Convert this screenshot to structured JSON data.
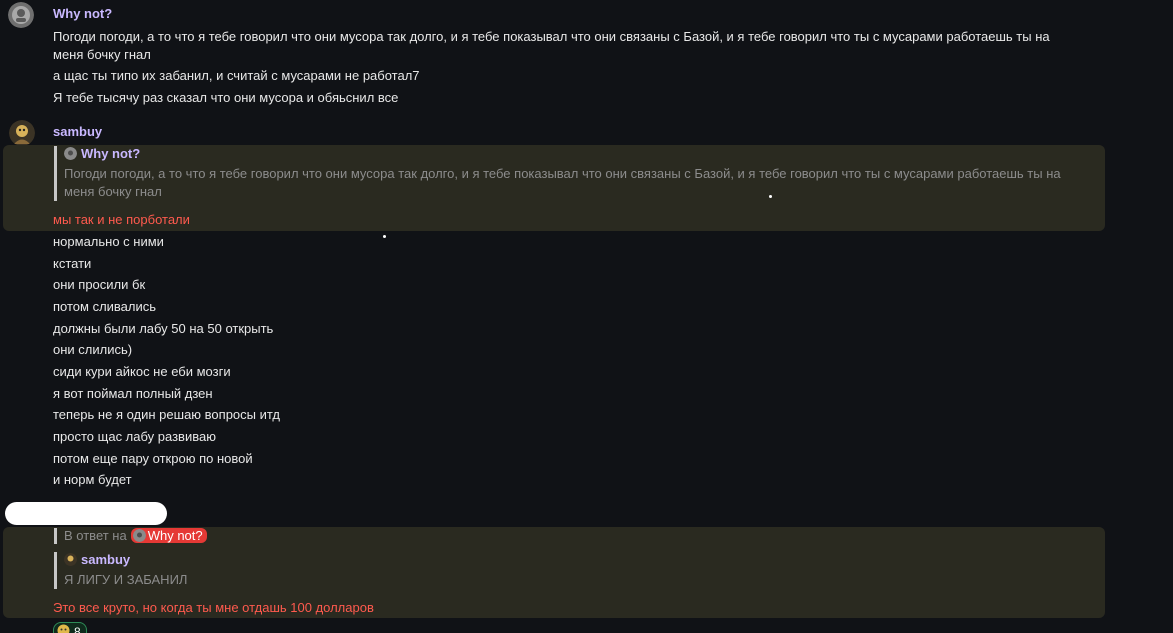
{
  "messages": [
    {
      "author": "Why not?",
      "lines": [
        "Погоди погоди, а то что я тебе говорил что они мусора так долго, и я тебе показывал что они связаны с Базой, и я тебе говорил что ты с мусарами работаешь ты на меня бочку гнал",
        "а щас ты типо их забанил, и считай с мусарами не работал7",
        "Я тебе тысячу раз сказал что они мусора и обяьснил все"
      ]
    },
    {
      "author": "sambuy",
      "quote": {
        "author": "Why not?",
        "text": "Погоди погоди, а то что я тебе говорил что они мусора так долго, и я тебе показывал что они связаны с Базой, и я тебе говорил что ты с мусарами работаешь ты на меня бочку гнал"
      },
      "highlighted_line": "мы так и не порботали",
      "lines": [
        "нормально с ними",
        "кстати",
        "они просили бк",
        "потом сливались",
        "должны были лабу 50 на 50 открыть",
        "они слились)",
        "сиди кури айкос не еби мозги",
        "я вот поймал полный дзен",
        "теперь не я один решаю вопросы итд",
        "просто щас лабу развиваю",
        "потом еще пару открою по новой",
        "и норм будет"
      ]
    },
    {
      "reply_prefix": "В ответ на",
      "reply_mention": "Why not?",
      "quote": {
        "author": "sambuy",
        "text": "Я ЛИГУ И ЗАБАНИЛ"
      },
      "highlighted_line": "Это все круто, но когда ты мне отдашь 100 долларов",
      "reaction": {
        "count": "8"
      }
    }
  ],
  "colors": {
    "background": "#101216",
    "author": "#c9b8ff",
    "highlight_bg": "#2a2a20",
    "mention_bg": "#e53935",
    "highlight_text": "#ff5a4e"
  }
}
